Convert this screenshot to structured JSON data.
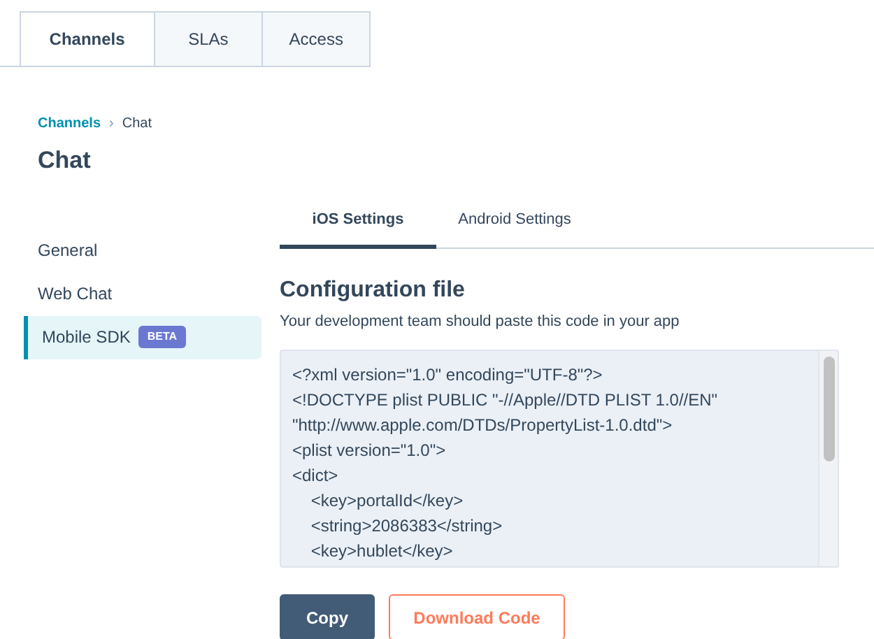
{
  "top_tabs": [
    {
      "label": "Channels",
      "selected": true
    },
    {
      "label": "SLAs",
      "selected": false
    },
    {
      "label": "Access",
      "selected": false
    }
  ],
  "breadcrumb": {
    "parent": "Channels",
    "separator": "›",
    "current": "Chat"
  },
  "page_title": "Chat",
  "sidebar": {
    "items": [
      {
        "label": "General",
        "selected": false
      },
      {
        "label": "Web Chat",
        "selected": false
      },
      {
        "label": "Mobile SDK",
        "selected": true,
        "badge": "BETA"
      }
    ]
  },
  "sub_tabs": [
    {
      "label": "iOS Settings",
      "selected": true
    },
    {
      "label": "Android Settings",
      "selected": false
    }
  ],
  "section": {
    "title": "Configuration file",
    "description": "Your development team should paste this code in your app"
  },
  "code_lines": [
    "<?xml version=\"1.0\" encoding=\"UTF-8\"?>",
    "<!DOCTYPE plist PUBLIC \"-//Apple//DTD PLIST 1.0//EN\"",
    "\"http://www.apple.com/DTDs/PropertyList-1.0.dtd\">",
    "<plist version=\"1.0\">",
    "<dict>",
    "\t<key>portalId</key>",
    "\t<string>2086383</string>",
    "\t<key>hublet</key>"
  ],
  "buttons": [
    {
      "label": "Copy",
      "kind": "primary"
    },
    {
      "label": "Download Code",
      "kind": "secondary"
    }
  ]
}
